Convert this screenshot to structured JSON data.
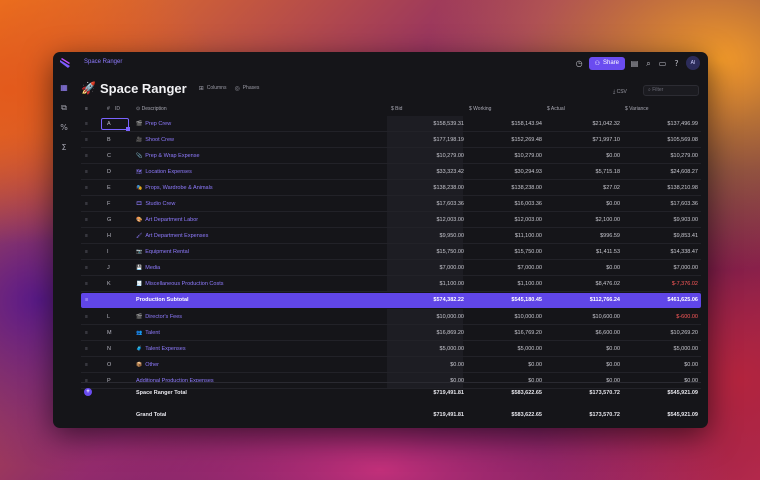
{
  "app": {
    "breadcrumb": "Space Ranger",
    "title": "Space Ranger",
    "title_icon": "rocket-emoji",
    "accent": "#6a4cf0"
  },
  "toolbar": {
    "columns_label": "Columns",
    "phases_label": "Phases",
    "csv_label": "CSV",
    "filter_placeholder": "Filter",
    "share_label": "Share",
    "avatar_initials": "AI"
  },
  "table": {
    "headers": {
      "hash": "#",
      "id": "ID",
      "description": "Description",
      "bid": "Bid",
      "working": "Working",
      "actual": "Actual",
      "variance": "Variance"
    },
    "rows": [
      {
        "code": "A",
        "icon": "🎬",
        "desc": "Prep Crew",
        "bid": "$158,539.31",
        "working": "$158,143.94",
        "actual": "$21,042.32",
        "variance": "$137,496.99",
        "neg": false
      },
      {
        "code": "B",
        "icon": "🎥",
        "desc": "Shoot Crew",
        "bid": "$177,198.19",
        "working": "$152,269.48",
        "actual": "$71,997.10",
        "variance": "$105,569.08",
        "neg": false
      },
      {
        "code": "C",
        "icon": "📎",
        "desc": "Prep & Wrap Expense",
        "bid": "$10,279.00",
        "working": "$10,279.00",
        "actual": "$0.00",
        "variance": "$10,279.00",
        "neg": false
      },
      {
        "code": "D",
        "icon": "🗺",
        "desc": "Location Expenses",
        "bid": "$33,323.42",
        "working": "$30,294.93",
        "actual": "$5,715.18",
        "variance": "$24,608.27",
        "neg": false
      },
      {
        "code": "E",
        "icon": "🎭",
        "desc": "Props, Wardrobe & Animals",
        "bid": "$138,238.00",
        "working": "$138,238.00",
        "actual": "$27.02",
        "variance": "$138,210.98",
        "neg": false
      },
      {
        "code": "F",
        "icon": "🎞",
        "desc": "Studio Crew",
        "bid": "$17,603.36",
        "working": "$16,003.36",
        "actual": "$0.00",
        "variance": "$17,603.36",
        "neg": false
      },
      {
        "code": "G",
        "icon": "🎨",
        "desc": "Art Department Labor",
        "bid": "$12,003.00",
        "working": "$12,003.00",
        "actual": "$2,100.00",
        "variance": "$9,903.00",
        "neg": false
      },
      {
        "code": "H",
        "icon": "🖌",
        "desc": "Art Department Expenses",
        "bid": "$9,950.00",
        "working": "$11,100.00",
        "actual": "$996.59",
        "variance": "$9,853.41",
        "neg": false
      },
      {
        "code": "I",
        "icon": "📷",
        "desc": "Equipment Rental",
        "bid": "$15,750.00",
        "working": "$15,750.00",
        "actual": "$1,411.53",
        "variance": "$14,338.47",
        "neg": false
      },
      {
        "code": "J",
        "icon": "💾",
        "desc": "Media",
        "bid": "$7,000.00",
        "working": "$7,000.00",
        "actual": "$0.00",
        "variance": "$7,000.00",
        "neg": false
      },
      {
        "code": "K",
        "icon": "🧾",
        "desc": "Miscellaneous Production Costs",
        "bid": "$1,100.00",
        "working": "$1,100.00",
        "actual": "$8,476.02",
        "variance": "$-7,376.02",
        "neg": true
      }
    ],
    "subtotal": {
      "label": "Production Subtotal",
      "bid": "$574,382.22",
      "working": "$545,180.45",
      "actual": "$112,766.24",
      "variance": "$461,625.06"
    },
    "rows2": [
      {
        "code": "L",
        "icon": "🎬",
        "desc": "Director's Fees",
        "bid": "$10,000.00",
        "working": "$10,000.00",
        "actual": "$10,600.00",
        "variance": "$-600.00",
        "neg": true
      },
      {
        "code": "M",
        "icon": "👥",
        "desc": "Talent",
        "bid": "$16,869.20",
        "working": "$16,769.20",
        "actual": "$6,600.00",
        "variance": "$10,269.20",
        "neg": false
      },
      {
        "code": "N",
        "icon": "🧳",
        "desc": "Talent Expenses",
        "bid": "$5,000.00",
        "working": "$5,000.00",
        "actual": "$0.00",
        "variance": "$5,000.00",
        "neg": false
      },
      {
        "code": "O",
        "icon": "📦",
        "desc": "Other",
        "bid": "$0.00",
        "working": "$0.00",
        "actual": "$0.00",
        "variance": "$0.00",
        "neg": false
      },
      {
        "code": "P",
        "icon": "",
        "desc": "Additional Production Expenses",
        "bid": "$0.00",
        "working": "$0.00",
        "actual": "$0.00",
        "variance": "$0.00",
        "neg": false
      }
    ],
    "footer": [
      {
        "label": "Space Ranger Total",
        "bid": "$719,491.81",
        "working": "$583,622.65",
        "actual": "$173,570.72",
        "variance": "$545,921.09"
      },
      {
        "label": "Grand Total",
        "bid": "$719,491.81",
        "working": "$583,622.65",
        "actual": "$173,570.72",
        "variance": "$545,921.09"
      }
    ]
  }
}
